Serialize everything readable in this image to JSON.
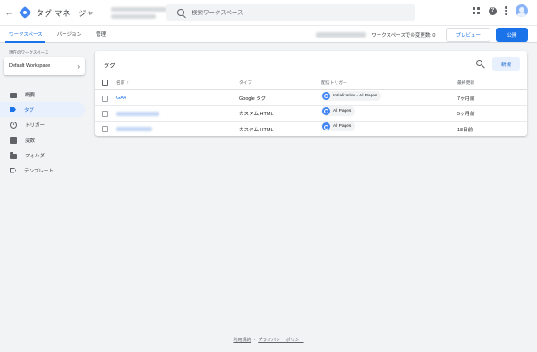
{
  "header": {
    "back_icon": "arrow-back-icon",
    "logo_icon": "tag-manager-logo",
    "app_title": "タグ マネージャー",
    "search_placeholder": "検索ワークスペース",
    "icons": [
      "apps-grid-icon",
      "help-icon",
      "more-vert-icon",
      "account-avatar"
    ]
  },
  "nav": {
    "tabs": [
      {
        "label": "ワークスペース",
        "active": true
      },
      {
        "label": "バージョン",
        "active": false
      },
      {
        "label": "管理",
        "active": false
      }
    ],
    "changes_label": "ワークスペースでの変更数: 0",
    "preview_label": "プレビュー",
    "publish_label": "公開"
  },
  "sidebar": {
    "current_workspace_label": "現在のワークスペース",
    "workspace_name": "Default Workspace",
    "items": [
      {
        "label": "概要",
        "icon": "briefcase-icon",
        "active": false
      },
      {
        "label": "タグ",
        "icon": "tag-icon",
        "active": true
      },
      {
        "label": "トリガー",
        "icon": "trigger-icon",
        "active": false
      },
      {
        "label": "変数",
        "icon": "variable-icon",
        "active": false
      },
      {
        "label": "フォルダ",
        "icon": "folder-icon",
        "active": false
      },
      {
        "label": "テンプレート",
        "icon": "template-icon",
        "active": false
      }
    ]
  },
  "tags_card": {
    "title": "タグ",
    "new_button": "新規",
    "columns": {
      "name": "名前",
      "type": "タイプ",
      "trigger": "配信トリガー",
      "updated": "最終更新"
    },
    "rows": [
      {
        "name": "GA4",
        "type": "Google タグ",
        "trigger": "Initialization - All Pages",
        "updated": "7ヶ月前"
      },
      {
        "name": "",
        "type": "カスタム HTML",
        "trigger": "All Pages",
        "updated": "5ヶ月前"
      },
      {
        "name": "",
        "type": "カスタム HTML",
        "trigger": "All Pages",
        "updated": "18日前"
      }
    ]
  },
  "footer": {
    "terms": "利用規約",
    "separator": "・",
    "privacy": "プライバシー ポリシー"
  },
  "colors": {
    "accent": "#1a73e8",
    "background": "#f1f3f4",
    "active_bg": "#e8f0fe"
  }
}
